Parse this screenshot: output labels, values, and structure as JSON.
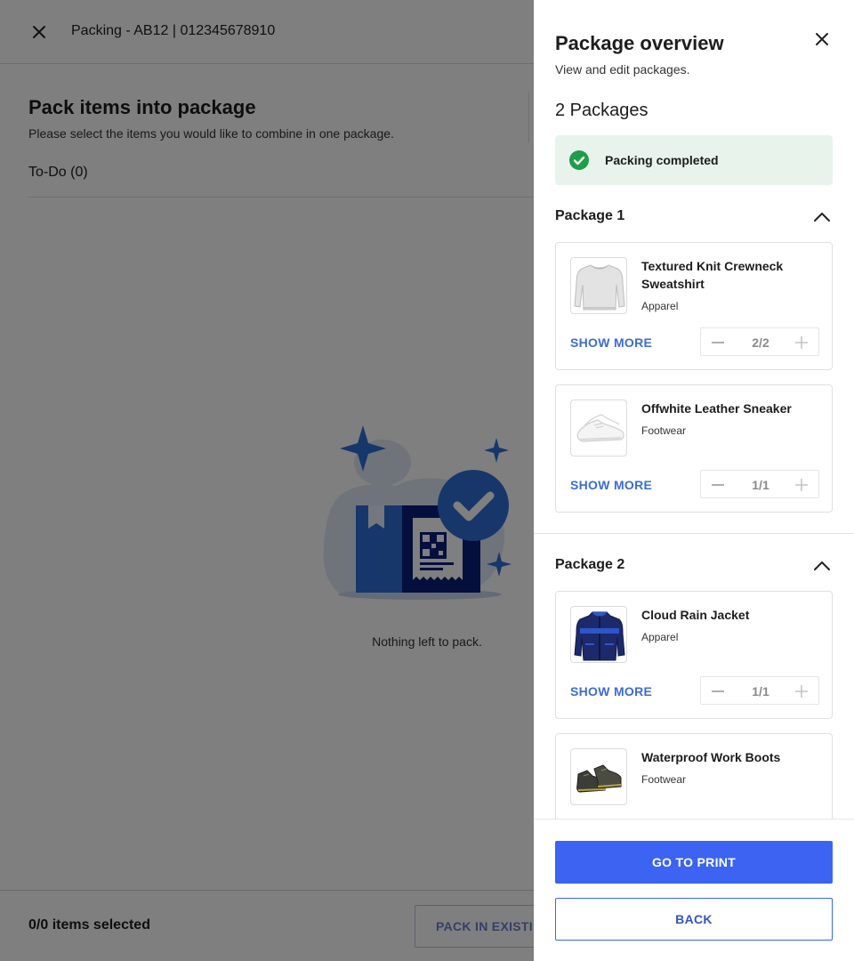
{
  "background": {
    "header_title": "Packing - AB12 | 012345678910",
    "heading": "Pack items into package",
    "subheading": "Please select the items you would like to combine in one package.",
    "todo_label": "To-Do (0)",
    "empty_message": "Nothing left to pack.",
    "selection_count": "0/0 items selected",
    "pack_existing_label": "PACK IN EXISTIN"
  },
  "drawer": {
    "title": "Package overview",
    "subtitle": "View and edit packages.",
    "package_count": "2 Packages",
    "status_text": "Packing completed",
    "show_more_label": "SHOW MORE",
    "packages": [
      {
        "title": "Package 1",
        "items": [
          {
            "name": "Textured Knit Crewneck Sweatshirt",
            "category": "Apparel",
            "quantity": "2/2",
            "icon": "sweatshirt-image"
          },
          {
            "name": "Offwhite Leather Sneaker",
            "category": "Footwear",
            "quantity": "1/1",
            "icon": "sneaker-image"
          }
        ]
      },
      {
        "title": "Package 2",
        "items": [
          {
            "name": "Cloud Rain Jacket",
            "category": "Apparel",
            "quantity": "1/1",
            "icon": "jacket-image"
          },
          {
            "name": "Waterproof Work Boots",
            "category": "Footwear",
            "icon": "boots-image"
          }
        ]
      }
    ],
    "buttons": {
      "print": "GO TO PRINT",
      "back": "BACK"
    }
  },
  "colors": {
    "primary": "#3c63f2",
    "link": "#3d6bd6",
    "success": "#1e9e4a",
    "success_bg": "#e8f3ec",
    "illustration_blue": "#2f6fd6",
    "illustration_navy": "#0b1f7a"
  }
}
